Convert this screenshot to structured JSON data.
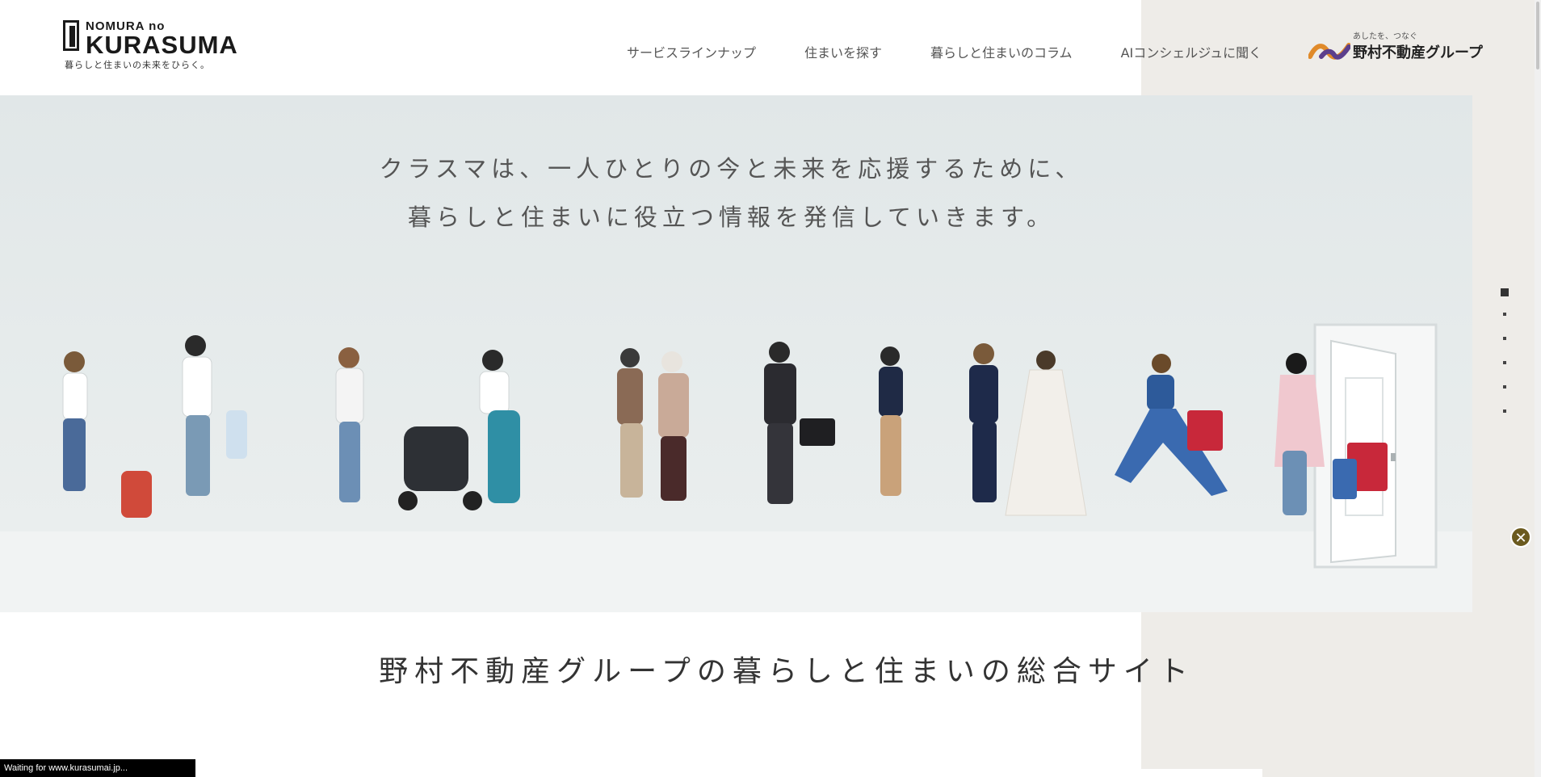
{
  "header": {
    "logo": {
      "small": "NOMURA no",
      "big": "KURASUMA",
      "tagline": "暮らしと住まいの未来をひらく。"
    },
    "nav": [
      {
        "label": "サービスラインナップ"
      },
      {
        "label": "住まいを探す"
      },
      {
        "label": "暮らしと住まいのコラム"
      },
      {
        "label": "AIコンシェルジュに聞く"
      }
    ],
    "group_logo": {
      "tagline": "あしたを、つなぐ",
      "name": "野村不動産グループ",
      "colors": [
        "#e08a2a",
        "#5b3f8c"
      ]
    }
  },
  "hero": {
    "line1": "クラスマは、一人ひとりの今と未来を応援するために、",
    "line2": "暮らしと住まいに役立つ情報を発信していきます。"
  },
  "site_title": "野村不動産グループの暮らしと住まいの総合サイト",
  "pagination": {
    "count": 6,
    "active": 0
  },
  "close_icon": "close-icon",
  "status_text": "Waiting for www.kurasumai.jp..."
}
